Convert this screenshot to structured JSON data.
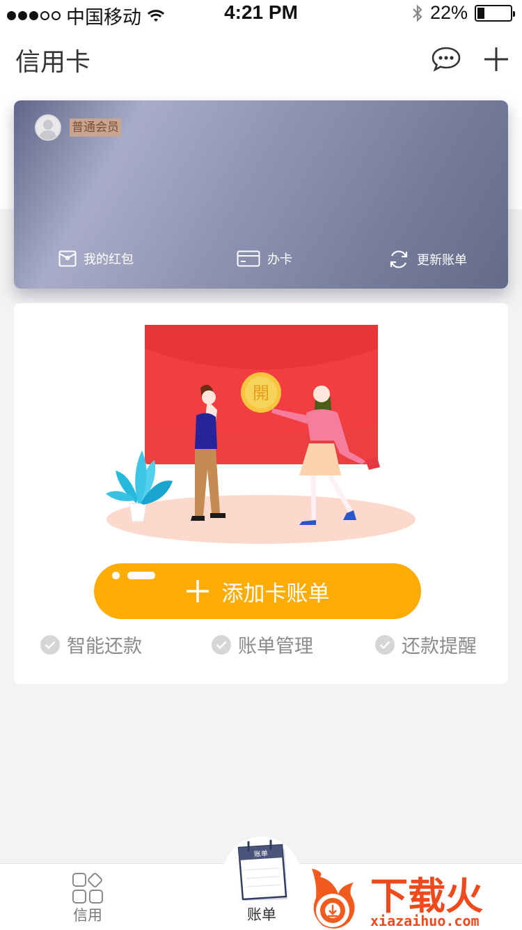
{
  "status_bar": {
    "carrier": "中国移动",
    "time": "4:21 PM",
    "battery_percent": "22%",
    "battery_level": 0.22,
    "signal_bars_filled": 3,
    "signal_bars_total": 5
  },
  "nav": {
    "title": "信用卡",
    "message_icon": "chat-bubble-icon",
    "add_icon": "plus-icon"
  },
  "card": {
    "member_level": "普通会员",
    "actions": [
      {
        "label": "我的红包",
        "icon": "red-packet-icon"
      },
      {
        "label": "办卡",
        "icon": "credit-card-icon"
      },
      {
        "label": "更新账单",
        "icon": "refresh-icon"
      }
    ]
  },
  "promo": {
    "coin_text": "開",
    "add_button": "添加卡账单",
    "features": [
      "智能还款",
      "账单管理",
      "还款提醒"
    ]
  },
  "tabbar": {
    "tabs": [
      {
        "label": "信用",
        "icon": "grid-icon"
      },
      {
        "label": "账单",
        "icon": "calendar-icon",
        "active": true
      }
    ],
    "calendar_badge": "账单"
  },
  "watermark": {
    "brand": "下载火",
    "url": "xiazaihuo.com"
  },
  "colors": {
    "accent": "#fdac03",
    "envelope": "#f04545",
    "card_gradient_start": "#5f6689",
    "card_gradient_mid": "#a9acc8"
  }
}
